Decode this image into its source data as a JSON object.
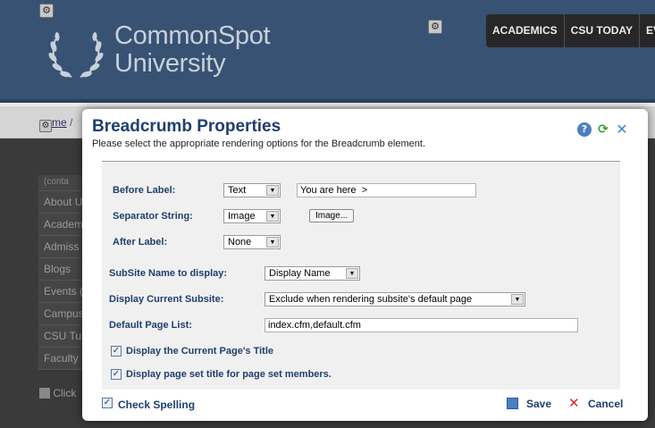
{
  "site": {
    "logo_line1": "CommonSpot",
    "logo_line2": "University",
    "nav": [
      "ACADEMICS",
      "CSU TODAY",
      "EV"
    ],
    "breadcrumb_link": "me",
    "breadcrumb_sep": "/",
    "side_nav": [
      "(conta",
      "About U",
      "Academ",
      "Admiss",
      "Blogs",
      "Events (",
      "Campus",
      "CSU Tu",
      "Faculty"
    ],
    "click_text": "Click",
    "gear_glyph": "⚙"
  },
  "dialog": {
    "title": "Breadcrumb Properties",
    "subtitle": "Please select the appropriate rendering options for the Breadcrumb element.",
    "icons": {
      "help": "?",
      "refresh": "⟳",
      "close": "✕"
    },
    "before_label": {
      "label": "Before Label:",
      "type": "Text",
      "value": "You are here  >"
    },
    "separator": {
      "label": "Separator String:",
      "type": "Image",
      "button": "Image..."
    },
    "after_label": {
      "label": "After Label:",
      "type": "None"
    },
    "subsite_name": {
      "label": "SubSite Name to display:",
      "value": "Display Name"
    },
    "current_subsite": {
      "label": "Display Current Subsite:",
      "value": "Exclude when rendering subsite's default page"
    },
    "default_page_list": {
      "label": "Default Page List:",
      "value": "index.cfm,default.cfm"
    },
    "checkbox_current_title": {
      "label": "Display the Current Page's Title",
      "checked": true
    },
    "checkbox_page_set": {
      "label": "Display page set title for page set members.",
      "checked": true
    },
    "check_spelling": {
      "label": "Check Spelling",
      "checked": true
    },
    "save_label": "Save",
    "cancel_label": "Cancel",
    "check_glyph": "✓",
    "arrow_glyph": "▼"
  }
}
